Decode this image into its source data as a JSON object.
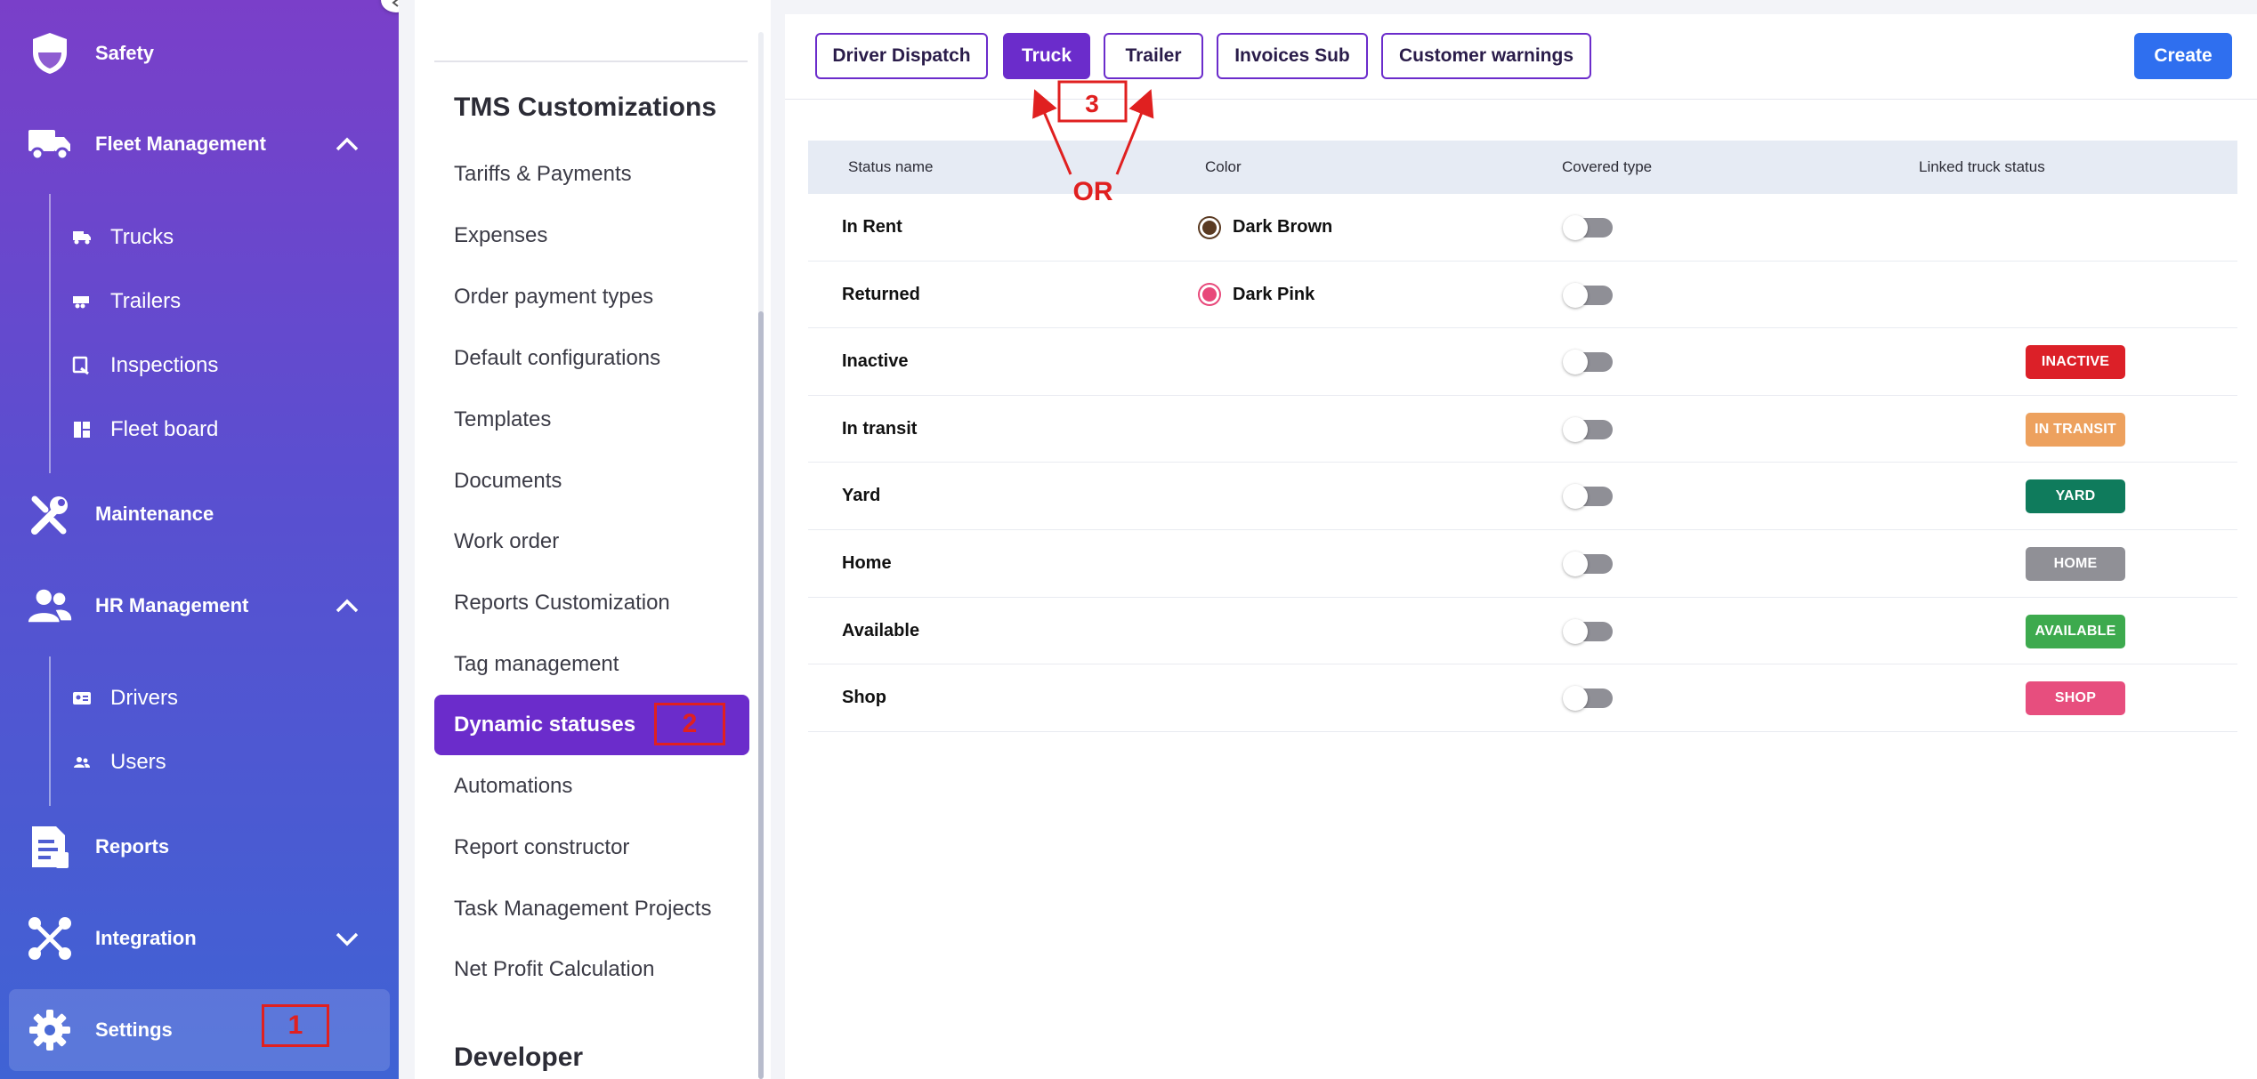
{
  "sidebar": {
    "items": [
      {
        "label": "Safety",
        "icon": "shield-icon"
      },
      {
        "label": "Fleet Management",
        "icon": "truck-icon",
        "expanded": true,
        "children": [
          {
            "label": "Trucks",
            "icon": "truck-small-icon"
          },
          {
            "label": "Trailers",
            "icon": "trailer-icon"
          },
          {
            "label": "Inspections",
            "icon": "inspection-icon"
          },
          {
            "label": "Fleet board",
            "icon": "board-icon"
          }
        ]
      },
      {
        "label": "Maintenance",
        "icon": "wrench-icon"
      },
      {
        "label": "HR Management",
        "icon": "people-icon",
        "expanded": true,
        "children": [
          {
            "label": "Drivers",
            "icon": "id-card-icon"
          },
          {
            "label": "Users",
            "icon": "users-icon"
          }
        ]
      },
      {
        "label": "Reports",
        "icon": "report-icon"
      },
      {
        "label": "Integration",
        "icon": "integration-icon",
        "expanded": false
      },
      {
        "label": "Settings",
        "icon": "gear-icon",
        "active": true
      }
    ]
  },
  "annotations": {
    "one": "1",
    "two": "2",
    "three": "3",
    "or": "OR"
  },
  "settings_menu": {
    "section_title": "TMS Customizations",
    "items": [
      "Tariffs & Payments",
      "Expenses",
      "Order payment types",
      "Default configurations",
      "Templates",
      "Documents",
      "Work order",
      "Reports Customization",
      "Tag management",
      "Dynamic statuses",
      "Automations",
      "Report constructor",
      "Task Management Projects",
      "Net Profit Calculation"
    ],
    "active_item": "Dynamic statuses",
    "next_section_title": "Developer"
  },
  "tabs": [
    {
      "label": "Driver Dispatch",
      "active": false
    },
    {
      "label": "Truck",
      "active": true
    },
    {
      "label": "Trailer",
      "active": false
    },
    {
      "label": "Invoices Sub",
      "active": false
    },
    {
      "label": "Customer warnings",
      "active": false
    }
  ],
  "create_button": "Create",
  "table": {
    "columns": [
      "Status name",
      "Color",
      "Covered type",
      "Linked truck status"
    ],
    "rows": [
      {
        "name": "In Rent",
        "color_name": "Dark Brown",
        "color_hex": "#5a3a22",
        "covered": false,
        "linked": ""
      },
      {
        "name": "Returned",
        "color_name": "Dark Pink",
        "color_hex": "#e8487a",
        "covered": false,
        "linked": ""
      },
      {
        "name": "Inactive",
        "color_name": "",
        "color_hex": "",
        "covered": false,
        "linked": "INACTIVE",
        "linked_color": "#dc2028"
      },
      {
        "name": "In transit",
        "color_name": "",
        "color_hex": "",
        "covered": false,
        "linked": "IN TRANSIT",
        "linked_color": "#eda15e"
      },
      {
        "name": "Yard",
        "color_name": "",
        "color_hex": "",
        "covered": false,
        "linked": "YARD",
        "linked_color": "#0f7b5c"
      },
      {
        "name": "Home",
        "color_name": "",
        "color_hex": "",
        "covered": false,
        "linked": "HOME",
        "linked_color": "#909096"
      },
      {
        "name": "Available",
        "color_name": "",
        "color_hex": "",
        "covered": false,
        "linked": "AVAILABLE",
        "linked_color": "#3daa4e"
      },
      {
        "name": "Shop",
        "color_name": "",
        "color_hex": "",
        "covered": false,
        "linked": "SHOP",
        "linked_color": "#e74e7e"
      }
    ]
  },
  "colors": {
    "brand_purple": "#6b2ccb",
    "create_blue": "#2f6fef",
    "annotation_red": "#e02020"
  }
}
